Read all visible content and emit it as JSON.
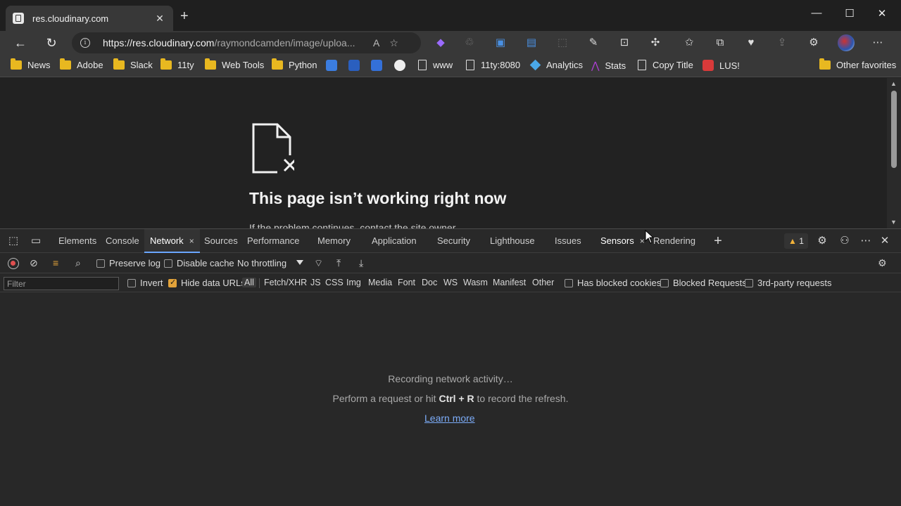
{
  "browser": {
    "tab_title": "res.cloudinary.com",
    "tab_close": "✕",
    "new_tab": "+",
    "url_host": "https://res.cloudinary.com",
    "url_path": "/raymondcamden/image/uploa...",
    "window": {
      "minimize": "—",
      "maximize": "☐",
      "close": "✕"
    }
  },
  "favorites": [
    {
      "label": "News",
      "icon": "folder-icon"
    },
    {
      "label": "Adobe",
      "icon": "folder-icon"
    },
    {
      "label": "Slack",
      "icon": "folder-icon"
    },
    {
      "label": "11ty",
      "icon": "folder-icon"
    },
    {
      "label": "Web Tools",
      "icon": "folder-icon"
    },
    {
      "label": "Python",
      "icon": "folder-icon"
    },
    {
      "label": "www",
      "icon": "page-icon"
    },
    {
      "label": "11ty:8080",
      "icon": "page-icon"
    },
    {
      "label": "Analytics",
      "icon": "diamond-icon"
    },
    {
      "label": "Stats",
      "icon": "stats-icon"
    },
    {
      "label": "Copy Title",
      "icon": "page-icon"
    },
    {
      "label": "LUS!",
      "icon": "lus-icon"
    },
    {
      "label": "Other favorites",
      "icon": "folder-icon"
    }
  ],
  "page": {
    "error_title": "This page isn’t working right now",
    "error_sub": "If the problem continues, contact the site owner."
  },
  "devtools": {
    "tabs": [
      "Elements",
      "Console",
      "Network",
      "Sources",
      "Performance",
      "Memory",
      "Application",
      "Security",
      "Lighthouse",
      "Issues",
      "Sensors",
      "Rendering"
    ],
    "active_tab": "Network",
    "tab_close": "×",
    "issues_count": "1",
    "toolbar": {
      "preserve_log": "Preserve log",
      "disable_cache": "Disable cache",
      "throttling": "No throttling"
    },
    "filter": {
      "placeholder": "Filter",
      "invert": "Invert",
      "hide_data_urls": "Hide data URLs",
      "types": [
        "All",
        "Fetch/XHR",
        "JS",
        "CSS",
        "Img",
        "Media",
        "Font",
        "Doc",
        "WS",
        "Wasm",
        "Manifest",
        "Other"
      ],
      "has_blocked_cookies": "Has blocked cookies",
      "blocked_requests": "Blocked Requests",
      "third_party": "3rd-party requests"
    },
    "empty": {
      "recording": "Recording network activity…",
      "perform_prefix": "Perform a request or hit ",
      "shortcut": "Ctrl + R",
      "perform_suffix": " to record the refresh.",
      "learn_more": "Learn more"
    }
  },
  "colors": {
    "accent_blue": "#6aa6ff",
    "link": "#7cacf8",
    "folder": "#e8b820",
    "checkbox_checked": "#e3a33a",
    "record_red": "#e05050"
  }
}
